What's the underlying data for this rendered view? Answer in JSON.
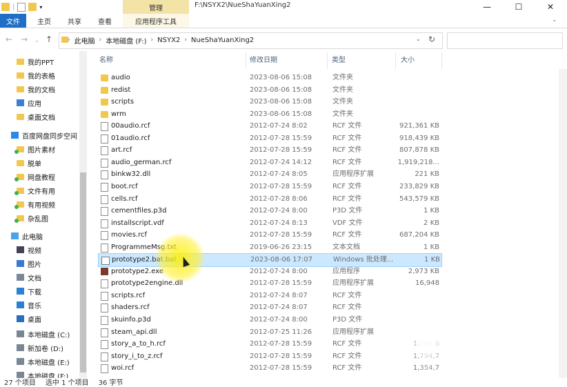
{
  "window": {
    "manage_tab": "管理",
    "title": "F:\\NSYX2\\NueShaYuanXing2",
    "minimize": "—",
    "maximize": "☐",
    "close": "✕"
  },
  "ribbon": {
    "tabs": [
      "文件",
      "主页",
      "共享",
      "查看"
    ],
    "contextual": "应用程序工具"
  },
  "address": {
    "crumbs": [
      "此电脑",
      "本地磁盘 (F:)",
      "NSYX2",
      "NueShaYuanXing2"
    ],
    "refresh": "↻",
    "search_placeholder": ""
  },
  "navpane": {
    "items": [
      {
        "label": "我的PPT",
        "icon": "folder-icon"
      },
      {
        "label": "我的表格",
        "icon": "folder-icon"
      },
      {
        "label": "我的文档",
        "icon": "folder-icon"
      },
      {
        "label": "应用",
        "icon": "apps-icon"
      },
      {
        "label": "桌面文档",
        "icon": "folder-icon"
      },
      {
        "label": "百度网盘同步空间",
        "icon": "baidu-cloud-icon"
      },
      {
        "label": "图片素材",
        "icon": "synced-folder-icon"
      },
      {
        "label": "脱单",
        "icon": "folder-icon"
      },
      {
        "label": "网盘教程",
        "icon": "synced-folder-icon"
      },
      {
        "label": "文件有用",
        "icon": "synced-folder-icon"
      },
      {
        "label": "有用视频",
        "icon": "synced-folder-icon"
      },
      {
        "label": "杂乱图",
        "icon": "synced-folder-icon"
      },
      {
        "label": "此电脑",
        "icon": "computer-icon"
      },
      {
        "label": "视频",
        "icon": "video-icon"
      },
      {
        "label": "图片",
        "icon": "picture-icon"
      },
      {
        "label": "文档",
        "icon": "document-icon"
      },
      {
        "label": "下载",
        "icon": "download-icon"
      },
      {
        "label": "音乐",
        "icon": "music-icon"
      },
      {
        "label": "桌面",
        "icon": "desktop-icon"
      },
      {
        "label": "本地磁盘 (C:)",
        "icon": "drive-icon"
      },
      {
        "label": "新加卷 (D:)",
        "icon": "drive-icon"
      },
      {
        "label": "本地磁盘 (E:)",
        "icon": "drive-icon"
      },
      {
        "label": "本地磁盘 (F:)",
        "icon": "drive-icon"
      }
    ]
  },
  "columns": {
    "name": "名称",
    "date": "修改日期",
    "type": "类型",
    "size": "大小"
  },
  "files": [
    {
      "name": "audio",
      "date": "2023-08-06 15:08",
      "type": "文件夹",
      "size": "",
      "icon": "folder"
    },
    {
      "name": "redist",
      "date": "2023-08-06 15:08",
      "type": "文件夹",
      "size": "",
      "icon": "folder"
    },
    {
      "name": "scripts",
      "date": "2023-08-06 15:08",
      "type": "文件夹",
      "size": "",
      "icon": "folder"
    },
    {
      "name": "wrm",
      "date": "2023-08-06 15:08",
      "type": "文件夹",
      "size": "",
      "icon": "folder"
    },
    {
      "name": "00audio.rcf",
      "date": "2012-07-24 8:02",
      "type": "RCF 文件",
      "size": "921,361 KB",
      "icon": "file"
    },
    {
      "name": "01audio.rcf",
      "date": "2012-07-28 15:59",
      "type": "RCF 文件",
      "size": "918,439 KB",
      "icon": "file"
    },
    {
      "name": "art.rcf",
      "date": "2012-07-28 15:59",
      "type": "RCF 文件",
      "size": "807,878 KB",
      "icon": "file"
    },
    {
      "name": "audio_german.rcf",
      "date": "2012-07-24 14:12",
      "type": "RCF 文件",
      "size": "1,919,218...",
      "icon": "file"
    },
    {
      "name": "binkw32.dll",
      "date": "2012-07-24 8:05",
      "type": "应用程序扩展",
      "size": "221 KB",
      "icon": "file"
    },
    {
      "name": "boot.rcf",
      "date": "2012-07-28 15:59",
      "type": "RCF 文件",
      "size": "233,829 KB",
      "icon": "file"
    },
    {
      "name": "cells.rcf",
      "date": "2012-07-28 8:06",
      "type": "RCF 文件",
      "size": "543,579 KB",
      "icon": "file"
    },
    {
      "name": "cementfiles.p3d",
      "date": "2012-07-24 8:00",
      "type": "P3D 文件",
      "size": "1 KB",
      "icon": "file"
    },
    {
      "name": "installscript.vdf",
      "date": "2012-07-24 8:13",
      "type": "VDF 文件",
      "size": "2 KB",
      "icon": "file"
    },
    {
      "name": "movies.rcf",
      "date": "2012-07-28 15:59",
      "type": "RCF 文件",
      "size": "687,204 KB",
      "icon": "file"
    },
    {
      "name": "ProgrammeMsg.txt",
      "date": "2019-06-26 23:15",
      "type": "文本文档",
      "size": "1 KB",
      "icon": "file"
    },
    {
      "name": "prototype2.bat.bat",
      "date": "2023-08-06 17:07",
      "type": "Windows 批处理...",
      "size": "1 KB",
      "icon": "bat",
      "selected": true
    },
    {
      "name": "prototype2.exe",
      "date": "2012-07-24 8:00",
      "type": "应用程序",
      "size": "2,973 KB",
      "icon": "exe"
    },
    {
      "name": "prototype2engine.dll",
      "date": "2012-07-28 15:59",
      "type": "应用程序扩展",
      "size": "16,948",
      "icon": "file"
    },
    {
      "name": "scripts.rcf",
      "date": "2012-07-24 8:07",
      "type": "RCF 文件",
      "size": "",
      "icon": "file"
    },
    {
      "name": "shaders.rcf",
      "date": "2012-07-24 8:07",
      "type": "RCF 文件",
      "size": "",
      "icon": "file"
    },
    {
      "name": "skuinfo.p3d",
      "date": "2012-07-24 8:00",
      "type": "P3D 文件",
      "size": "",
      "icon": "file"
    },
    {
      "name": "steam_api.dll",
      "date": "2012-07-25 11:26",
      "type": "应用程序扩展",
      "size": "",
      "icon": "file"
    },
    {
      "name": "story_a_to_h.rcf",
      "date": "2012-07-28 15:59",
      "type": "RCF 文件",
      "size": "1,066,6",
      "icon": "file"
    },
    {
      "name": "story_i_to_z.rcf",
      "date": "2012-07-28 15:59",
      "type": "RCF 文件",
      "size": "1,794,7",
      "icon": "file"
    },
    {
      "name": "woi.rcf",
      "date": "2012-07-28 15:59",
      "type": "RCF 文件",
      "size": "1,354,7",
      "icon": "file"
    }
  ],
  "status": {
    "count": "27 个项目",
    "selected": "选中 1 个项目",
    "size": "36 字节"
  }
}
